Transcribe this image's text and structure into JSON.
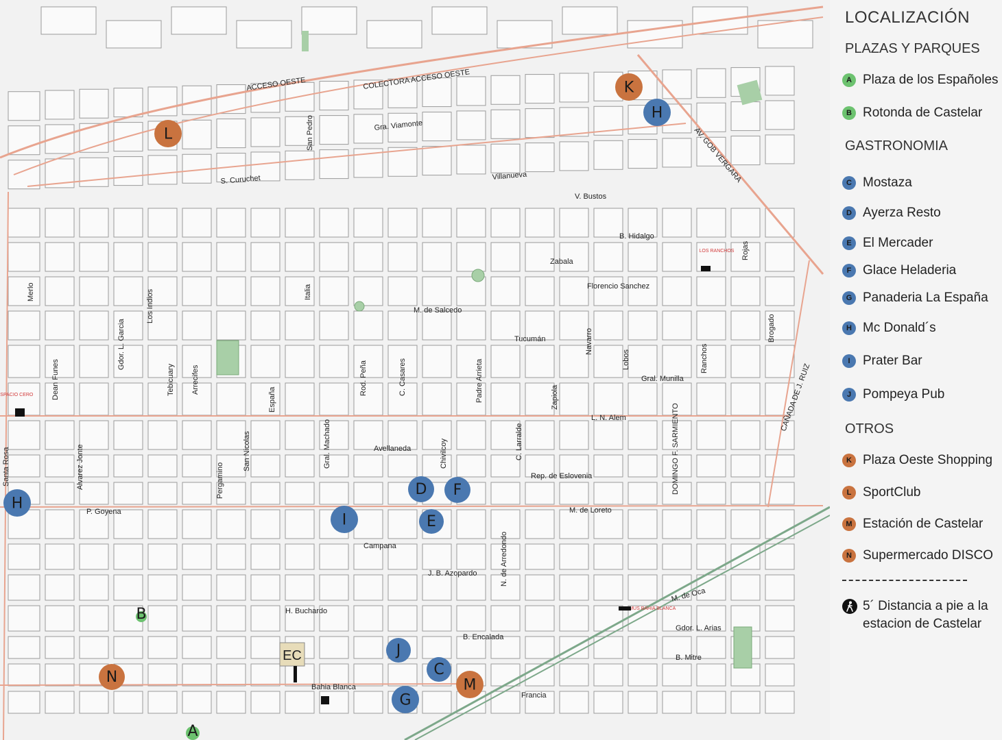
{
  "legend": {
    "title": "LOCALIZACIÓN",
    "sections": [
      {
        "heading": "PLAZAS Y PARQUES",
        "color": "#6cc26f",
        "items": [
          {
            "key": "A",
            "label": "Plaza de los Españoles"
          },
          {
            "key": "B",
            "label": "Rotonda de Castelar"
          }
        ]
      },
      {
        "heading": "GASTRONOMIA",
        "color": "#4a78b0",
        "items": [
          {
            "key": "C",
            "label": "Mostaza"
          },
          {
            "key": "D",
            "label": "Ayerza Resto"
          },
          {
            "key": "E",
            "label": "El Mercader"
          },
          {
            "key": "F",
            "label": "Glace Heladeria"
          },
          {
            "key": "G",
            "label": "Panaderia La España"
          },
          {
            "key": "H",
            "label": "Mc Donald´s"
          },
          {
            "key": "I",
            "label": "Prater Bar"
          },
          {
            "key": "J",
            "label": "Pompeya Pub"
          }
        ]
      },
      {
        "heading": "OTROS",
        "color": "#c9733f",
        "items": [
          {
            "key": "K",
            "label": "Plaza Oeste Shopping"
          },
          {
            "key": "L",
            "label": "SportClub"
          },
          {
            "key": "M",
            "label": "Estación de Castelar"
          },
          {
            "key": "N",
            "label": "Supermercado DISCO"
          }
        ]
      }
    ],
    "walk_note_line1": "5´ Distancia a pie a la",
    "walk_note_line2": "estacion de Castelar",
    "walk_icon": "pedestrian-icon"
  },
  "map": {
    "markers": [
      {
        "key": "K",
        "category": "otros"
      },
      {
        "key": "H",
        "category": "gastronomia"
      },
      {
        "key": "L",
        "category": "otros"
      },
      {
        "key": "H",
        "category": "gastronomia"
      },
      {
        "key": "D",
        "category": "gastronomia"
      },
      {
        "key": "F",
        "category": "gastronomia"
      },
      {
        "key": "I",
        "category": "gastronomia"
      },
      {
        "key": "E",
        "category": "gastronomia"
      },
      {
        "key": "J",
        "category": "gastronomia"
      },
      {
        "key": "C",
        "category": "gastronomia"
      },
      {
        "key": "M",
        "category": "otros"
      },
      {
        "key": "G",
        "category": "gastronomia"
      },
      {
        "key": "N",
        "category": "otros"
      },
      {
        "key": "A",
        "category": "plazas"
      },
      {
        "key": "B",
        "category": "plazas"
      }
    ],
    "ec_label": "EC",
    "small_labels": [
      "ESPACIO CERO",
      "LOS RANCHOS",
      "DOMUS BAHIA BLANCA"
    ],
    "streets": [
      "ACCESO OESTE",
      "COLECTORA ACCESO OESTE",
      "Gra. Viamonte",
      "S. Curuchet",
      "San Pedro",
      "Villanueva",
      "V. Bustos",
      "AV. GOB VERGARA",
      "B. Hidalgo",
      "Zabala",
      "Florencio Sanchez",
      "Rojas",
      "Merlo",
      "Italia",
      "Los Indios",
      "Gdor. L. Garcia",
      "M. de Salcedo",
      "Tucumán",
      "Navarro",
      "Lobos",
      "Brogado",
      "Dean Funes",
      "Tebicuary",
      "Arrecifes",
      "España",
      "Rod. Peña",
      "C. Casares",
      "Padre Arrieta",
      "Zapiola",
      "Gral. Munilla",
      "Ranchos",
      "CAÑADA DE J. RUIZ",
      "L. N. Alem",
      "Santa Rosa",
      "Alvarez Jonte",
      "Pergamino",
      "San Nicolas",
      "Gral. Machado",
      "Avellaneda",
      "Chivilcoy",
      "C. Larralde",
      "Rep. de Eslovenia",
      "DOMINGO F. SARMIENTO",
      "P. Goyena",
      "M. de Loreto",
      "Campana",
      "J. B. Azopardo",
      "N. de Arredondo",
      "M. de Oca",
      "H. Buchardo",
      "B. Encalada",
      "Gdor. L. Arias",
      "B. Mitre",
      "Bahia Blanca",
      "Francia"
    ]
  }
}
